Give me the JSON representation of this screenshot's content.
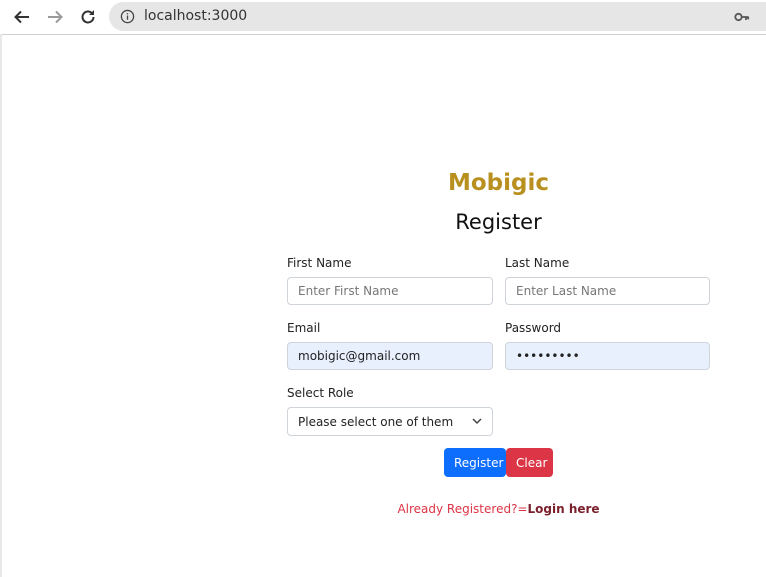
{
  "browser": {
    "url": "localhost:3000",
    "icons": [
      "back-arrow-icon",
      "forward-arrow-icon",
      "reload-icon",
      "info-icon",
      "key-icon"
    ]
  },
  "form": {
    "brand": "Mobigic",
    "title": "Register",
    "first_name": {
      "label": "First Name",
      "placeholder": "Enter First Name",
      "value": ""
    },
    "last_name": {
      "label": "Last Name",
      "placeholder": "Enter Last Name",
      "value": ""
    },
    "email": {
      "label": "Email",
      "value": "mobigic@gmail.com"
    },
    "password": {
      "label": "Password",
      "value": "•••••••••"
    },
    "role": {
      "label": "Select Role",
      "selected": "Please select one of them"
    },
    "register_label": "Register",
    "clear_label": "Clear",
    "already_text": "Already Registered?=",
    "login_text": "Login here"
  },
  "colors": {
    "brand": "#b8901f",
    "primary": "#0d6efd",
    "danger": "#dc3545",
    "autofill": "#e8f0fe"
  }
}
